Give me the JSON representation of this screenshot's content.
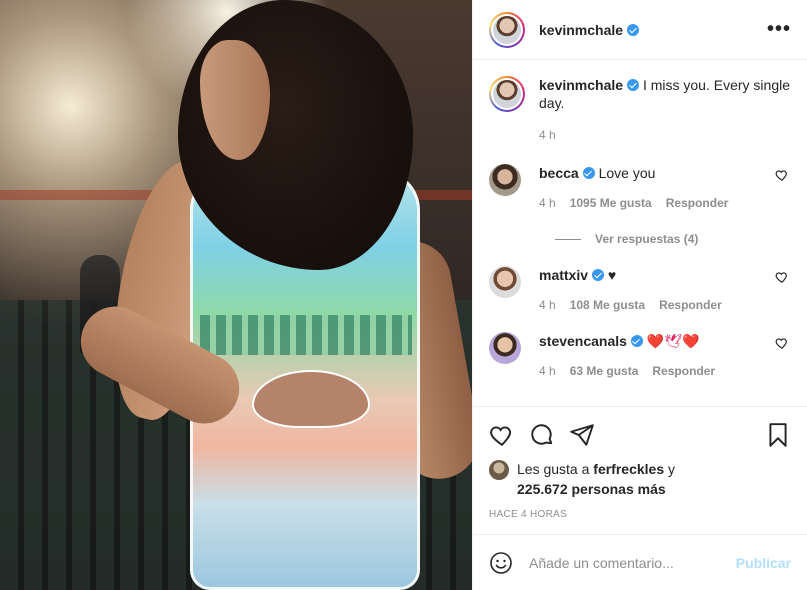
{
  "post": {
    "author": {
      "username": "kevinmchale",
      "verified": true
    },
    "caption": {
      "text": "I miss you. Every single day.",
      "time": "4 h"
    },
    "comments": [
      {
        "username": "becca",
        "verified": true,
        "text": "Love you",
        "time": "4 h",
        "likes": "1095 Me gusta",
        "reply": "Responder",
        "replies_label": "Ver respuestas (4)"
      },
      {
        "username": "mattxiv",
        "verified": true,
        "text": "♥",
        "time": "4 h",
        "likes": "108 Me gusta",
        "reply": "Responder"
      },
      {
        "username": "stevencanals",
        "verified": true,
        "text": "❤️🕊❤️",
        "time": "4 h",
        "likes": "63 Me gusta",
        "reply": "Responder"
      }
    ],
    "likes": {
      "prefix": "Les gusta a",
      "user": "ferfreckles",
      "conj": "y",
      "count": "225.672 personas más"
    },
    "posted_ago": "HACE 4 HORAS",
    "add_comment": {
      "placeholder": "Añade un comentario...",
      "publish": "Publicar"
    }
  },
  "icons": {
    "more": "more-options-icon",
    "like": "heart-icon",
    "comment": "comment-icon",
    "share": "share-icon",
    "save": "bookmark-icon",
    "emoji": "emoji-icon"
  },
  "colors": {
    "verified": "#3897f0",
    "publish_disabled": "#b2dffc",
    "muted": "#8e8e8e"
  }
}
